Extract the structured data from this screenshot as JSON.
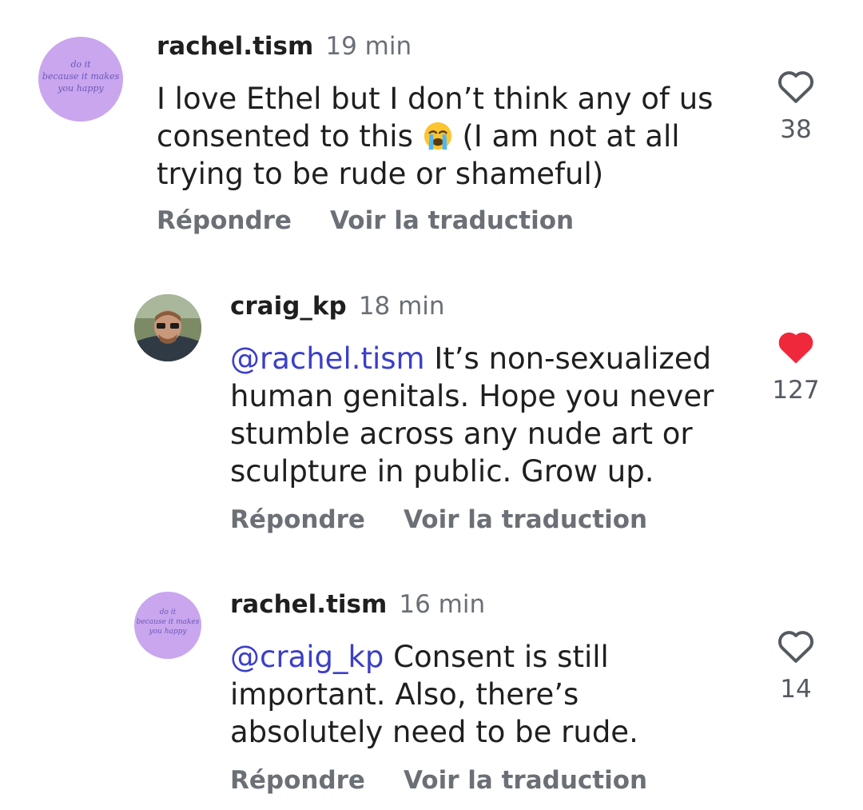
{
  "comments": [
    {
      "username": "rachel.tism",
      "time": "19 min",
      "mention": "",
      "text_before_emoji": "I love Ethel but I don’t think any of us consented to this ",
      "emoji_name": "loudly-crying-face-emoji",
      "text_after_emoji": " (I am not at all trying to be rude or shameful)",
      "likes": "38",
      "liked": false,
      "avatar_text": [
        "do it",
        "because it makes",
        "you happy"
      ],
      "reply_label": "Répondre",
      "translate_label": "Voir la traduction"
    },
    {
      "username": "craig_kp",
      "time": "18 min",
      "mention": "@rachel.tism",
      "text": " It’s non-sexualized human genitals. Hope you never stumble across any nude art or sculpture in public. Grow up.",
      "likes": "127",
      "liked": true,
      "reply_label": "Répondre",
      "translate_label": "Voir la traduction"
    },
    {
      "username": "rachel.tism",
      "time": "16 min",
      "mention": "@craig_kp",
      "text": " Consent is still important. Also, there’s absolutely need to be rude.",
      "likes": "14",
      "liked": false,
      "avatar_text": [
        "do it",
        "because it makes",
        "you happy"
      ],
      "reply_label": "Répondre",
      "translate_label": "Voir la traduction"
    }
  ],
  "colors": {
    "mention": "#3b3fc7",
    "liked_heart": "#f0283c",
    "secondary_text": "#6b6f76",
    "avatar_lilac": "#c9a6ee"
  },
  "icons": {
    "heart_outline": "heart-outline-icon",
    "heart_filled": "heart-filled-icon",
    "mention_prefix": "threads-at-icon"
  }
}
